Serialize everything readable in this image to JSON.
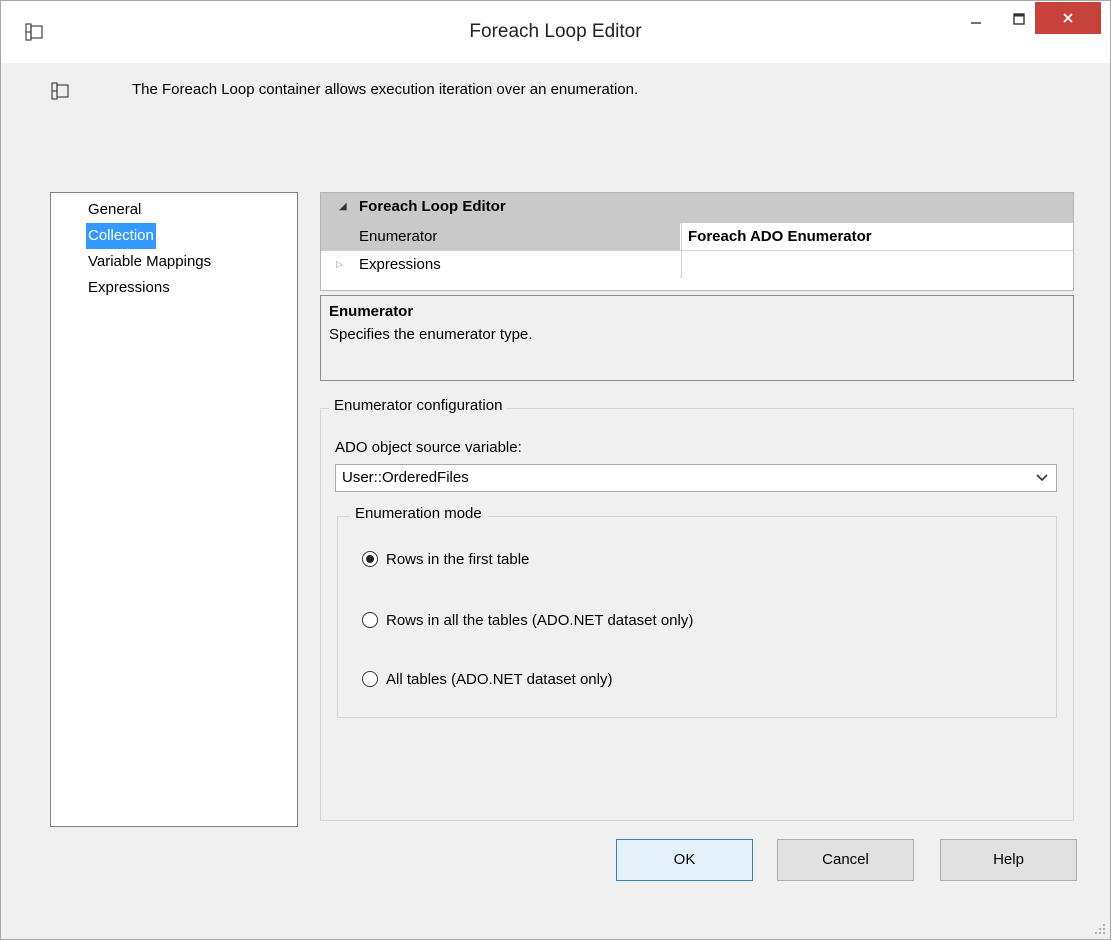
{
  "window": {
    "title": "Foreach Loop Editor",
    "icon": "foreach-container-icon",
    "controls": {
      "minimize": "minimize-icon",
      "maximize": "maximize-icon",
      "close": "close-icon"
    },
    "close_color": "#c7423b"
  },
  "description": "The Foreach Loop container allows execution iteration over an enumeration.",
  "nav": {
    "items": [
      {
        "label": "General",
        "selected": false
      },
      {
        "label": "Collection",
        "selected": true
      },
      {
        "label": "Variable Mappings",
        "selected": false
      },
      {
        "label": "Expressions",
        "selected": false
      }
    ],
    "selected_color": "#3399ff"
  },
  "property_grid": {
    "category": "Foreach Loop Editor",
    "rows": [
      {
        "name": "Enumerator",
        "value": "Foreach ADO Enumerator"
      },
      {
        "name": "Expressions",
        "value": ""
      }
    ]
  },
  "help_panel": {
    "title": "Enumerator",
    "description": "Specifies the enumerator type."
  },
  "enumerator_config": {
    "legend": "Enumerator configuration",
    "source_variable_label": "ADO object source variable:",
    "source_variable_value": "User::OrderedFiles",
    "enumeration_mode": {
      "legend": "Enumeration mode",
      "options": [
        {
          "label": "Rows in the first table",
          "checked": true
        },
        {
          "label": "Rows in all the tables (ADO.NET dataset only)",
          "checked": false
        },
        {
          "label": "All tables (ADO.NET dataset only)",
          "checked": false
        }
      ]
    }
  },
  "buttons": {
    "ok": "OK",
    "cancel": "Cancel",
    "help": "Help"
  }
}
